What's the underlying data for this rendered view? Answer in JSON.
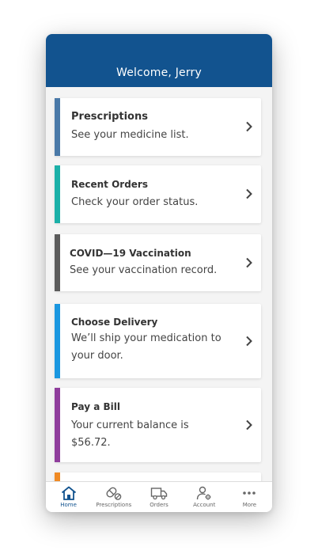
{
  "header": {
    "title": "Welcome, Jerry"
  },
  "cards": [
    {
      "title": "Prescriptions",
      "subtitle": "See your medicine list.",
      "accent": "#4a79a8"
    },
    {
      "title": "Recent Orders",
      "subtitle": "Check your order status.",
      "accent": "#1bb0a8"
    },
    {
      "title": "COVID—19 Vaccination",
      "subtitle": "See your vaccination record.",
      "accent": "#5b5b5b"
    },
    {
      "title": "Choose Delivery",
      "subtitle": "We’ll ship your medication to your door.",
      "accent": "#1a97e0"
    },
    {
      "title": "Pay a Bill",
      "subtitle": "Your current balance is $56.72.",
      "accent": "#8f3d9c"
    },
    {
      "title": "",
      "subtitle": "",
      "accent": "#f08a24"
    }
  ],
  "tabbar": {
    "items": [
      {
        "label": "Home",
        "icon": "home-icon",
        "active": true
      },
      {
        "label": "Prescriptions",
        "icon": "pill-icon",
        "active": false
      },
      {
        "label": "Orders",
        "icon": "truck-icon",
        "active": false
      },
      {
        "label": "Account",
        "icon": "user-gear-icon",
        "active": false
      },
      {
        "label": "More",
        "icon": "more-dots-icon",
        "active": false
      }
    ]
  },
  "colors": {
    "brand": "#12538f",
    "chevron": "#444444"
  }
}
